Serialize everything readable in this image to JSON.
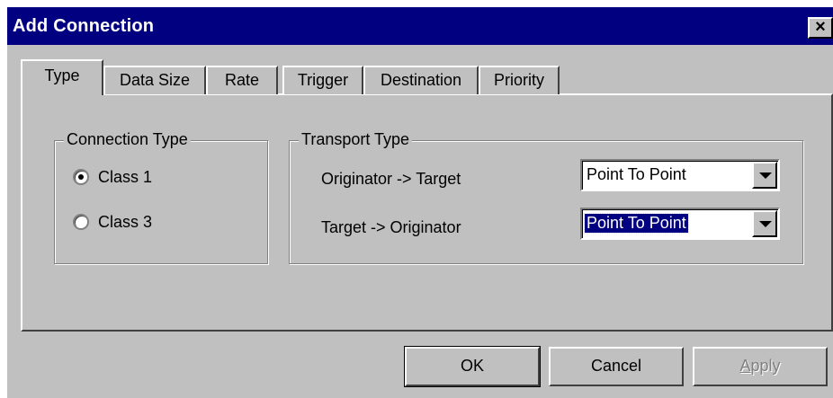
{
  "window": {
    "title": "Add Connection",
    "close_glyph": "×"
  },
  "tabs": [
    {
      "label": "Type",
      "active": true
    },
    {
      "label": "Data Size",
      "active": false
    },
    {
      "label": "Rate",
      "active": false
    },
    {
      "label": "Trigger",
      "active": false
    },
    {
      "label": "Destination",
      "active": false
    },
    {
      "label": "Priority",
      "active": false
    }
  ],
  "connection_type": {
    "legend": "Connection Type",
    "options": [
      {
        "label": "Class 1",
        "checked": true
      },
      {
        "label": "Class 3",
        "checked": false
      }
    ]
  },
  "transport_type": {
    "legend": "Transport Type",
    "originator_to_target": {
      "label": "Originator -> Target",
      "value": "Point To Point"
    },
    "target_to_originator": {
      "label": "Target -> Originator",
      "value": "Point To Point"
    }
  },
  "buttons": {
    "ok": "OK",
    "cancel": "Cancel",
    "apply_mnemonic": "A",
    "apply_rest": "pply"
  },
  "colors": {
    "titlebar": "#000080",
    "face": "#c0c0c0",
    "selection": "#000080"
  },
  "icons": {
    "close": "close-icon",
    "dropdown": "chevron-down-icon"
  }
}
